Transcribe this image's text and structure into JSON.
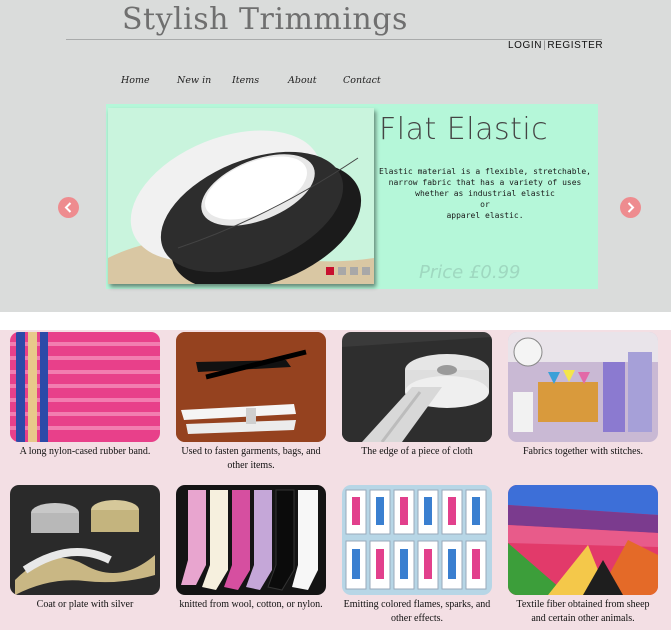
{
  "site": {
    "logo": "Stylish Trimmings"
  },
  "auth": {
    "login": "LOGIN",
    "separator": "|",
    "register": "REGISTER"
  },
  "nav": {
    "home": "Home",
    "new_in": "New in",
    "items": "Items",
    "about": "About",
    "contact": "Contact"
  },
  "slider": {
    "title": "Flat Elastic",
    "description": [
      "Elastic material is a flexible, stretchable,",
      "narrow fabric that has a variety of uses",
      "whether as industrial elastic",
      "or",
      "apparel elastic."
    ],
    "price": "Price £0.99",
    "dots": 4,
    "active_dot": 1,
    "prev_glyph": "‹",
    "next_glyph": "›"
  },
  "products": [
    {
      "caption": "A long nylon-cased rubber band.",
      "icon": "elastic-bands-image"
    },
    {
      "caption": "Used to fasten garments, bags, and other items.",
      "icon": "zippers-image"
    },
    {
      "caption": "The edge of a piece of cloth",
      "icon": "selvedge-rolls-image"
    },
    {
      "caption": "Fabrics together with stitches.",
      "icon": "sewing-notions-image"
    },
    {
      "caption": "Coat or plate with silver",
      "icon": "silver-ribbon-image"
    },
    {
      "caption": "knitted from wool, cotton, or nylon.",
      "icon": "socks-image"
    },
    {
      "caption": "Emitting colored flames, sparks, and other effects.",
      "icon": "number-candles-image"
    },
    {
      "caption": "Textile fiber obtained from sheep and certain other animals.",
      "icon": "felt-sheets-image"
    }
  ],
  "colors": {
    "header_bg": "#dadcdb",
    "slide_bg": "#b5f7d9",
    "arrow": "#ee8c8f",
    "grid_bg": "#f3dfe4",
    "dot_active": "#c8102e"
  }
}
